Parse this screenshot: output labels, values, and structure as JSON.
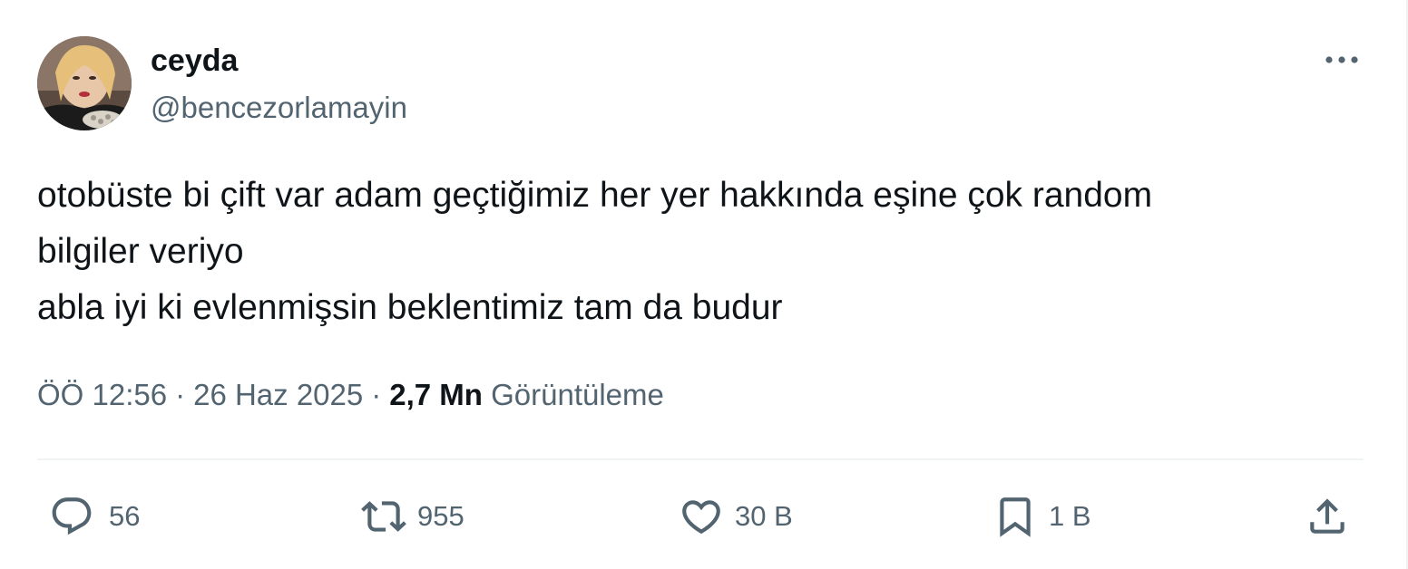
{
  "tweet": {
    "author": {
      "display_name": "ceyda",
      "handle": "@bencezorlamayin"
    },
    "text_lines": [
      "otobüste bi çift var adam geçtiğimiz her yer hakkında eşine çok random",
      "bilgiler veriyo",
      "abla iyi ki evlenmişsin beklentimiz tam da budur"
    ],
    "time": "ÖÖ 12:56",
    "date": "26 Haz 2025",
    "separator": "·",
    "views_count": "2,7 Mn",
    "views_label": "Görüntüleme"
  },
  "actions": {
    "reply": {
      "icon": "reply-icon",
      "count": "56"
    },
    "retweet": {
      "icon": "retweet-icon",
      "count": "955"
    },
    "like": {
      "icon": "heart-icon",
      "count": "30 B"
    },
    "bookmark": {
      "icon": "bookmark-icon",
      "count": "1 B"
    },
    "share": {
      "icon": "share-icon"
    }
  },
  "colors": {
    "text_primary": "#0f1419",
    "text_secondary": "#536471",
    "divider": "#eff3f4",
    "background": "#ffffff"
  }
}
